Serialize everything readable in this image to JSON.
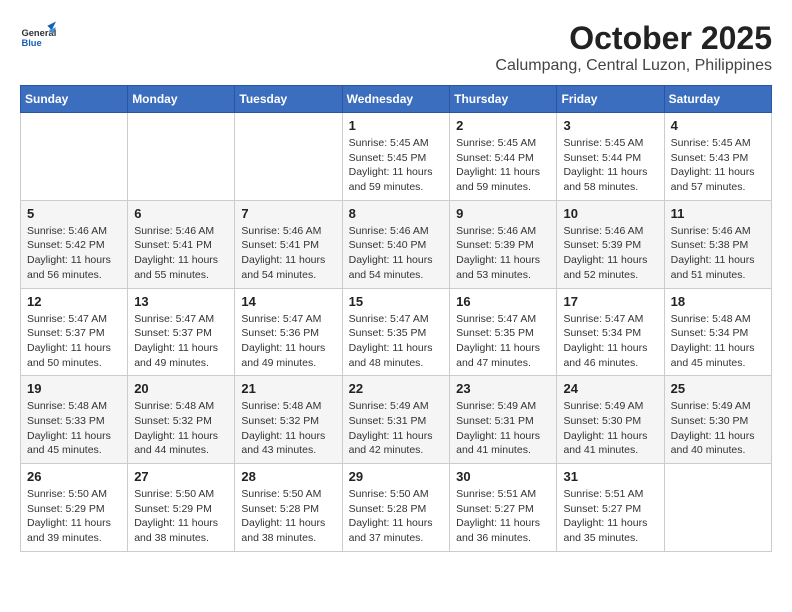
{
  "header": {
    "logo": {
      "line1": "General",
      "line2": "Blue"
    },
    "title": "October 2025",
    "location": "Calumpang, Central Luzon, Philippines"
  },
  "weekdays": [
    "Sunday",
    "Monday",
    "Tuesday",
    "Wednesday",
    "Thursday",
    "Friday",
    "Saturday"
  ],
  "weeks": [
    [
      {
        "day": "",
        "info": ""
      },
      {
        "day": "",
        "info": ""
      },
      {
        "day": "",
        "info": ""
      },
      {
        "day": "1",
        "sunrise": "Sunrise: 5:45 AM",
        "sunset": "Sunset: 5:45 PM",
        "daylight": "Daylight: 11 hours and 59 minutes."
      },
      {
        "day": "2",
        "sunrise": "Sunrise: 5:45 AM",
        "sunset": "Sunset: 5:44 PM",
        "daylight": "Daylight: 11 hours and 59 minutes."
      },
      {
        "day": "3",
        "sunrise": "Sunrise: 5:45 AM",
        "sunset": "Sunset: 5:44 PM",
        "daylight": "Daylight: 11 hours and 58 minutes."
      },
      {
        "day": "4",
        "sunrise": "Sunrise: 5:45 AM",
        "sunset": "Sunset: 5:43 PM",
        "daylight": "Daylight: 11 hours and 57 minutes."
      }
    ],
    [
      {
        "day": "5",
        "sunrise": "Sunrise: 5:46 AM",
        "sunset": "Sunset: 5:42 PM",
        "daylight": "Daylight: 11 hours and 56 minutes."
      },
      {
        "day": "6",
        "sunrise": "Sunrise: 5:46 AM",
        "sunset": "Sunset: 5:41 PM",
        "daylight": "Daylight: 11 hours and 55 minutes."
      },
      {
        "day": "7",
        "sunrise": "Sunrise: 5:46 AM",
        "sunset": "Sunset: 5:41 PM",
        "daylight": "Daylight: 11 hours and 54 minutes."
      },
      {
        "day": "8",
        "sunrise": "Sunrise: 5:46 AM",
        "sunset": "Sunset: 5:40 PM",
        "daylight": "Daylight: 11 hours and 54 minutes."
      },
      {
        "day": "9",
        "sunrise": "Sunrise: 5:46 AM",
        "sunset": "Sunset: 5:39 PM",
        "daylight": "Daylight: 11 hours and 53 minutes."
      },
      {
        "day": "10",
        "sunrise": "Sunrise: 5:46 AM",
        "sunset": "Sunset: 5:39 PM",
        "daylight": "Daylight: 11 hours and 52 minutes."
      },
      {
        "day": "11",
        "sunrise": "Sunrise: 5:46 AM",
        "sunset": "Sunset: 5:38 PM",
        "daylight": "Daylight: 11 hours and 51 minutes."
      }
    ],
    [
      {
        "day": "12",
        "sunrise": "Sunrise: 5:47 AM",
        "sunset": "Sunset: 5:37 PM",
        "daylight": "Daylight: 11 hours and 50 minutes."
      },
      {
        "day": "13",
        "sunrise": "Sunrise: 5:47 AM",
        "sunset": "Sunset: 5:37 PM",
        "daylight": "Daylight: 11 hours and 49 minutes."
      },
      {
        "day": "14",
        "sunrise": "Sunrise: 5:47 AM",
        "sunset": "Sunset: 5:36 PM",
        "daylight": "Daylight: 11 hours and 49 minutes."
      },
      {
        "day": "15",
        "sunrise": "Sunrise: 5:47 AM",
        "sunset": "Sunset: 5:35 PM",
        "daylight": "Daylight: 11 hours and 48 minutes."
      },
      {
        "day": "16",
        "sunrise": "Sunrise: 5:47 AM",
        "sunset": "Sunset: 5:35 PM",
        "daylight": "Daylight: 11 hours and 47 minutes."
      },
      {
        "day": "17",
        "sunrise": "Sunrise: 5:47 AM",
        "sunset": "Sunset: 5:34 PM",
        "daylight": "Daylight: 11 hours and 46 minutes."
      },
      {
        "day": "18",
        "sunrise": "Sunrise: 5:48 AM",
        "sunset": "Sunset: 5:34 PM",
        "daylight": "Daylight: 11 hours and 45 minutes."
      }
    ],
    [
      {
        "day": "19",
        "sunrise": "Sunrise: 5:48 AM",
        "sunset": "Sunset: 5:33 PM",
        "daylight": "Daylight: 11 hours and 45 minutes."
      },
      {
        "day": "20",
        "sunrise": "Sunrise: 5:48 AM",
        "sunset": "Sunset: 5:32 PM",
        "daylight": "Daylight: 11 hours and 44 minutes."
      },
      {
        "day": "21",
        "sunrise": "Sunrise: 5:48 AM",
        "sunset": "Sunset: 5:32 PM",
        "daylight": "Daylight: 11 hours and 43 minutes."
      },
      {
        "day": "22",
        "sunrise": "Sunrise: 5:49 AM",
        "sunset": "Sunset: 5:31 PM",
        "daylight": "Daylight: 11 hours and 42 minutes."
      },
      {
        "day": "23",
        "sunrise": "Sunrise: 5:49 AM",
        "sunset": "Sunset: 5:31 PM",
        "daylight": "Daylight: 11 hours and 41 minutes."
      },
      {
        "day": "24",
        "sunrise": "Sunrise: 5:49 AM",
        "sunset": "Sunset: 5:30 PM",
        "daylight": "Daylight: 11 hours and 41 minutes."
      },
      {
        "day": "25",
        "sunrise": "Sunrise: 5:49 AM",
        "sunset": "Sunset: 5:30 PM",
        "daylight": "Daylight: 11 hours and 40 minutes."
      }
    ],
    [
      {
        "day": "26",
        "sunrise": "Sunrise: 5:50 AM",
        "sunset": "Sunset: 5:29 PM",
        "daylight": "Daylight: 11 hours and 39 minutes."
      },
      {
        "day": "27",
        "sunrise": "Sunrise: 5:50 AM",
        "sunset": "Sunset: 5:29 PM",
        "daylight": "Daylight: 11 hours and 38 minutes."
      },
      {
        "day": "28",
        "sunrise": "Sunrise: 5:50 AM",
        "sunset": "Sunset: 5:28 PM",
        "daylight": "Daylight: 11 hours and 38 minutes."
      },
      {
        "day": "29",
        "sunrise": "Sunrise: 5:50 AM",
        "sunset": "Sunset: 5:28 PM",
        "daylight": "Daylight: 11 hours and 37 minutes."
      },
      {
        "day": "30",
        "sunrise": "Sunrise: 5:51 AM",
        "sunset": "Sunset: 5:27 PM",
        "daylight": "Daylight: 11 hours and 36 minutes."
      },
      {
        "day": "31",
        "sunrise": "Sunrise: 5:51 AM",
        "sunset": "Sunset: 5:27 PM",
        "daylight": "Daylight: 11 hours and 35 minutes."
      },
      {
        "day": "",
        "info": ""
      }
    ]
  ]
}
